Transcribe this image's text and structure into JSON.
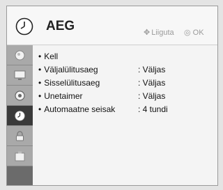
{
  "header": {
    "title": "AEG",
    "nav_hint": "Liiguta",
    "ok_hint": "OK"
  },
  "sidebar": {
    "items": [
      {
        "icon": "picture-icon",
        "active": false
      },
      {
        "icon": "monitor-icon",
        "active": false
      },
      {
        "icon": "speaker-icon",
        "active": false
      },
      {
        "icon": "clock-icon",
        "active": true
      },
      {
        "icon": "lock-icon",
        "active": false
      },
      {
        "icon": "options-icon",
        "active": false
      }
    ]
  },
  "menu": {
    "rows": [
      {
        "label": "Kell",
        "value": ""
      },
      {
        "label": "Väljalülitusaeg",
        "value": ": Väljas"
      },
      {
        "label": "Sisselülitusaeg",
        "value": ": Väljas"
      },
      {
        "label": "Unetaimer",
        "value": ": Väljas"
      },
      {
        "label": "Automaatne seisak",
        "value": ": 4 tundi"
      }
    ]
  }
}
